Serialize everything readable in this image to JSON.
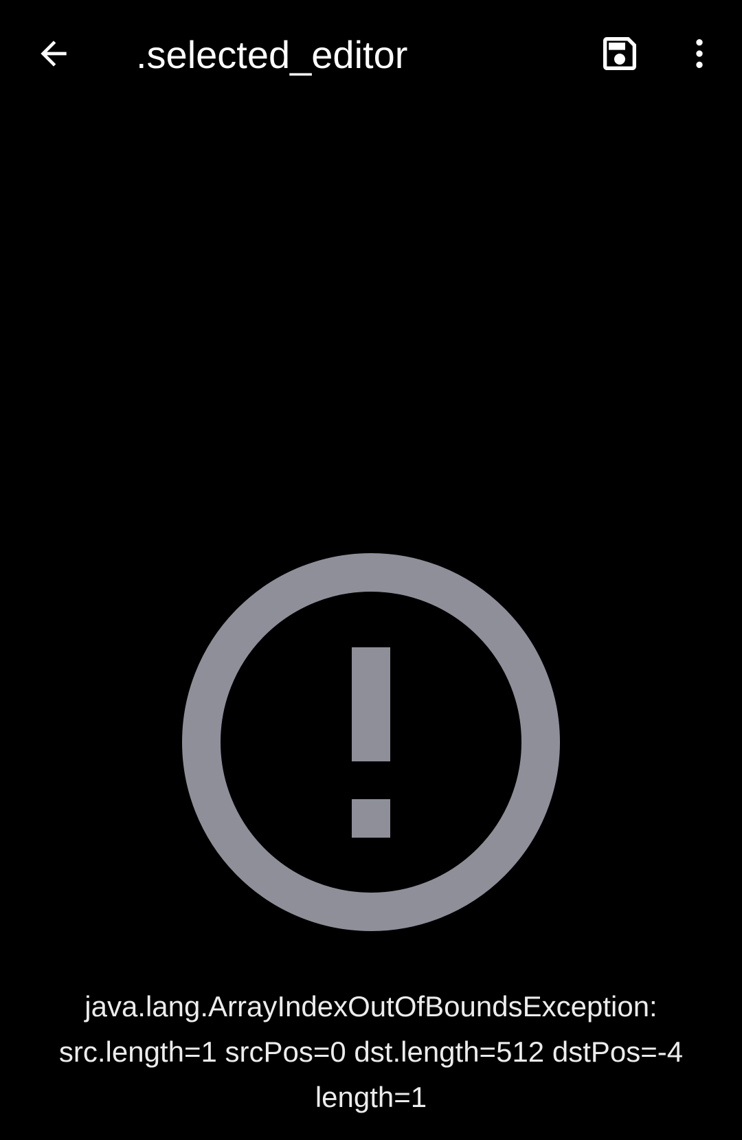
{
  "toolbar": {
    "title": ".selected_editor",
    "icons": {
      "back": "arrow-back-icon",
      "save": "floppy-disk-save-icon",
      "more": "more-vertical-icon"
    }
  },
  "main": {
    "icon": "error-exclamation-circle-icon",
    "error_lines": [
      "java.lang.ArrayIndexOutOfBoundsException:",
      "src.length=1 srcPos=0 dst.length=512 dstPos=-4",
      "length=1"
    ]
  },
  "colors": {
    "background": "#000000",
    "foreground": "#ffffff",
    "error_icon": "#8e8f99"
  }
}
